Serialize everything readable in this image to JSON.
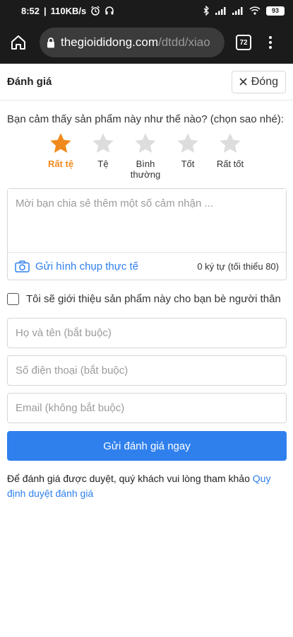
{
  "status_bar": {
    "time": "8:52",
    "speed": "110KB/s",
    "battery": "93",
    "icons": [
      "alarm-icon",
      "headset-icon",
      "bluetooth-icon",
      "signal-icon",
      "wifi-icon",
      "battery-icon"
    ]
  },
  "browser": {
    "url_host": "thegioididong.com",
    "url_path": "/dtdd/xiao",
    "tab_count": "72"
  },
  "header": {
    "title": "Đánh giá",
    "close_label": "Đóng"
  },
  "rating": {
    "question": "Bạn cảm thấy sản phẩm này như thế nào? (chọn sao nhé):",
    "selected": 1,
    "active_color": "#f08a1d",
    "inactive_color": "#dddddd",
    "stars": [
      {
        "label": "Rất tệ"
      },
      {
        "label": "Tệ"
      },
      {
        "label": "Bình thường"
      },
      {
        "label": "Tốt"
      },
      {
        "label": "Rất tốt"
      }
    ]
  },
  "comment": {
    "placeholder": "Mời bạn chia sẻ thêm một số cảm nhận ...",
    "photo_label": "Gửi hình chụp thực tế",
    "char_count": "0 ký tự (tối thiểu 80)"
  },
  "recommend": {
    "label": "Tôi sẽ giới thiệu sản phẩm này cho bạn bè người thân",
    "checked": false
  },
  "form": {
    "name_placeholder": "Họ và tên (bắt buộc)",
    "phone_placeholder": "Số điện thoại (bắt buộc)",
    "email_placeholder": "Email (không bắt buộc)",
    "submit_label": "Gửi đánh giá ngay"
  },
  "note": {
    "text": "Để đánh giá được duyệt, quý khách vui lòng tham khảo ",
    "link": "Quy định duyệt đánh giá"
  },
  "colors": {
    "primary": "#2f80ed",
    "star_active": "#f08a1d"
  }
}
